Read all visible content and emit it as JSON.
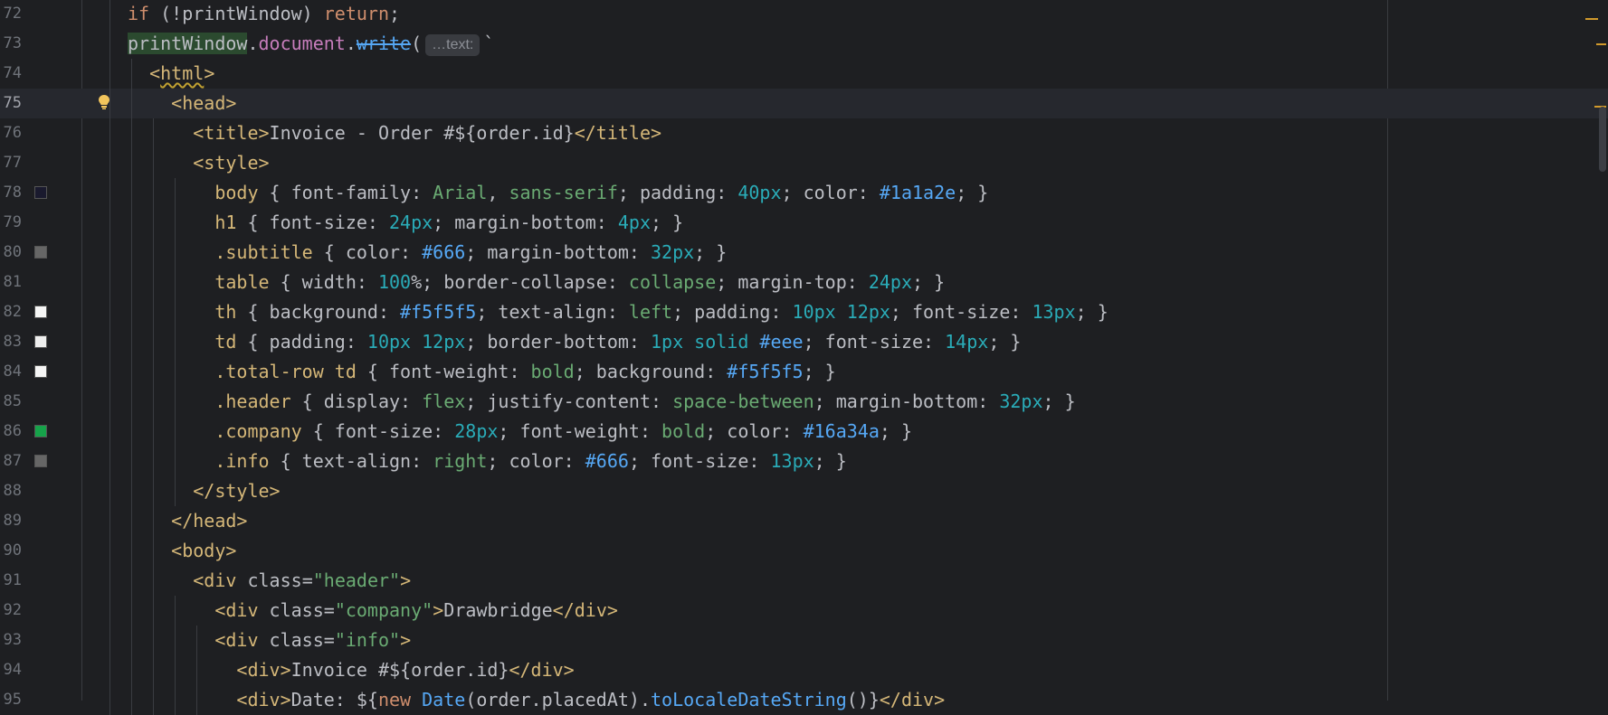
{
  "editor": {
    "lines": [
      {
        "num": "72",
        "swatch": null,
        "indent": "",
        "tokens": [
          {
            "t": "if",
            "c": "t-kw"
          },
          {
            "t": " (!printWindow) ",
            "c": "t-var"
          },
          {
            "t": "return",
            "c": "t-kw"
          },
          {
            "t": ";",
            "c": "t-var"
          }
        ]
      },
      {
        "num": "73",
        "swatch": null,
        "indent": "",
        "tokens": [
          {
            "t": "printWindow",
            "c": "t-var t-hl"
          },
          {
            "t": ".",
            "c": "t-var"
          },
          {
            "t": "document",
            "c": "t-field"
          },
          {
            "t": ".",
            "c": "t-var"
          },
          {
            "t": "write",
            "c": "t-fn"
          },
          {
            "t": "(",
            "c": "t-var"
          },
          {
            "t": "…text:",
            "c": "hint"
          },
          {
            "t": "`",
            "c": "t-var"
          }
        ]
      },
      {
        "num": "74",
        "swatch": null,
        "indent": "  ",
        "tokens": [
          {
            "t": "<",
            "c": "t-tag"
          },
          {
            "t": "html",
            "c": "t-tag t-warn"
          },
          {
            "t": ">",
            "c": "t-tag"
          }
        ]
      },
      {
        "num": "75",
        "swatch": null,
        "indent": "    ",
        "current": true,
        "tokens": [
          {
            "t": "<head>",
            "c": "t-tag"
          }
        ]
      },
      {
        "num": "76",
        "swatch": null,
        "indent": "      ",
        "tokens": [
          {
            "t": "<title>",
            "c": "t-tag"
          },
          {
            "t": "Invoice - Order #${order.id}",
            "c": "t-var"
          },
          {
            "t": "</title>",
            "c": "t-tag"
          }
        ]
      },
      {
        "num": "77",
        "swatch": null,
        "indent": "      ",
        "tokens": [
          {
            "t": "<style>",
            "c": "t-tag"
          }
        ]
      },
      {
        "num": "78",
        "swatch": "#1a1a2e",
        "indent": "        ",
        "tokens": [
          {
            "t": "body",
            "c": "t-sel"
          },
          {
            "t": " { font-family: ",
            "c": "t-prop"
          },
          {
            "t": "Arial",
            "c": "t-val"
          },
          {
            "t": ", ",
            "c": "t-prop"
          },
          {
            "t": "sans-serif",
            "c": "t-val"
          },
          {
            "t": "; padding: ",
            "c": "t-prop"
          },
          {
            "t": "40px",
            "c": "t-num"
          },
          {
            "t": "; color: ",
            "c": "t-prop"
          },
          {
            "t": "#1a1a2e",
            "c": "t-hex"
          },
          {
            "t": "; }",
            "c": "t-prop"
          }
        ]
      },
      {
        "num": "79",
        "swatch": null,
        "indent": "        ",
        "tokens": [
          {
            "t": "h1",
            "c": "t-sel"
          },
          {
            "t": " { font-size: ",
            "c": "t-prop"
          },
          {
            "t": "24px",
            "c": "t-num"
          },
          {
            "t": "; margin-bottom: ",
            "c": "t-prop"
          },
          {
            "t": "4px",
            "c": "t-num"
          },
          {
            "t": "; }",
            "c": "t-prop"
          }
        ]
      },
      {
        "num": "80",
        "swatch": "#666666",
        "indent": "        ",
        "tokens": [
          {
            "t": ".subtitle",
            "c": "t-sel"
          },
          {
            "t": " { color: ",
            "c": "t-prop"
          },
          {
            "t": "#666",
            "c": "t-hex"
          },
          {
            "t": "; margin-bottom: ",
            "c": "t-prop"
          },
          {
            "t": "32px",
            "c": "t-num"
          },
          {
            "t": "; }",
            "c": "t-prop"
          }
        ]
      },
      {
        "num": "81",
        "swatch": null,
        "indent": "        ",
        "tokens": [
          {
            "t": "table",
            "c": "t-sel"
          },
          {
            "t": " { width: ",
            "c": "t-prop"
          },
          {
            "t": "100",
            "c": "t-num"
          },
          {
            "t": "%; border-collapse: ",
            "c": "t-prop"
          },
          {
            "t": "collapse",
            "c": "t-val"
          },
          {
            "t": "; margin-top: ",
            "c": "t-prop"
          },
          {
            "t": "24px",
            "c": "t-num"
          },
          {
            "t": "; }",
            "c": "t-prop"
          }
        ]
      },
      {
        "num": "82",
        "swatch": "#f5f5f5",
        "indent": "        ",
        "tokens": [
          {
            "t": "th",
            "c": "t-sel"
          },
          {
            "t": " { background: ",
            "c": "t-prop"
          },
          {
            "t": "#f5f5f5",
            "c": "t-hex"
          },
          {
            "t": "; text-align: ",
            "c": "t-prop"
          },
          {
            "t": "left",
            "c": "t-val"
          },
          {
            "t": "; padding: ",
            "c": "t-prop"
          },
          {
            "t": "10px 12px",
            "c": "t-num"
          },
          {
            "t": "; font-size: ",
            "c": "t-prop"
          },
          {
            "t": "13px",
            "c": "t-num"
          },
          {
            "t": "; }",
            "c": "t-prop"
          }
        ]
      },
      {
        "num": "83",
        "swatch": "#eeeeee",
        "indent": "        ",
        "tokens": [
          {
            "t": "td",
            "c": "t-sel"
          },
          {
            "t": " { padding: ",
            "c": "t-prop"
          },
          {
            "t": "10px 12px",
            "c": "t-num"
          },
          {
            "t": "; border-bottom: ",
            "c": "t-prop"
          },
          {
            "t": "1px solid",
            "c": "t-num"
          },
          {
            "t": " ",
            "c": "t-prop"
          },
          {
            "t": "#eee",
            "c": "t-hex"
          },
          {
            "t": "; font-size: ",
            "c": "t-prop"
          },
          {
            "t": "14px",
            "c": "t-num"
          },
          {
            "t": "; }",
            "c": "t-prop"
          }
        ]
      },
      {
        "num": "84",
        "swatch": "#f5f5f5",
        "indent": "        ",
        "tokens": [
          {
            "t": ".total-row td",
            "c": "t-sel"
          },
          {
            "t": " { font-weight: ",
            "c": "t-prop"
          },
          {
            "t": "bold",
            "c": "t-val"
          },
          {
            "t": "; background: ",
            "c": "t-prop"
          },
          {
            "t": "#f5f5f5",
            "c": "t-hex"
          },
          {
            "t": "; }",
            "c": "t-prop"
          }
        ]
      },
      {
        "num": "85",
        "swatch": null,
        "indent": "        ",
        "tokens": [
          {
            "t": ".header",
            "c": "t-sel"
          },
          {
            "t": " { display: ",
            "c": "t-prop"
          },
          {
            "t": "flex",
            "c": "t-val"
          },
          {
            "t": "; justify-content: ",
            "c": "t-prop"
          },
          {
            "t": "space-between",
            "c": "t-val"
          },
          {
            "t": "; margin-bottom: ",
            "c": "t-prop"
          },
          {
            "t": "32px",
            "c": "t-num"
          },
          {
            "t": "; }",
            "c": "t-prop"
          }
        ]
      },
      {
        "num": "86",
        "swatch": "#16a34a",
        "indent": "        ",
        "tokens": [
          {
            "t": ".company",
            "c": "t-sel"
          },
          {
            "t": " { font-size: ",
            "c": "t-prop"
          },
          {
            "t": "28px",
            "c": "t-num"
          },
          {
            "t": "; font-weight: ",
            "c": "t-prop"
          },
          {
            "t": "bold",
            "c": "t-val"
          },
          {
            "t": "; color: ",
            "c": "t-prop"
          },
          {
            "t": "#16a34a",
            "c": "t-hex"
          },
          {
            "t": "; }",
            "c": "t-prop"
          }
        ]
      },
      {
        "num": "87",
        "swatch": "#666666",
        "indent": "        ",
        "tokens": [
          {
            "t": ".info",
            "c": "t-sel"
          },
          {
            "t": " { text-align: ",
            "c": "t-prop"
          },
          {
            "t": "right",
            "c": "t-val"
          },
          {
            "t": "; color: ",
            "c": "t-prop"
          },
          {
            "t": "#666",
            "c": "t-hex"
          },
          {
            "t": "; font-size: ",
            "c": "t-prop"
          },
          {
            "t": "13px",
            "c": "t-num"
          },
          {
            "t": "; }",
            "c": "t-prop"
          }
        ]
      },
      {
        "num": "88",
        "swatch": null,
        "indent": "      ",
        "tokens": [
          {
            "t": "</style>",
            "c": "t-tag"
          }
        ]
      },
      {
        "num": "89",
        "swatch": null,
        "indent": "    ",
        "tokens": [
          {
            "t": "</head>",
            "c": "t-tag"
          }
        ]
      },
      {
        "num": "90",
        "swatch": null,
        "indent": "    ",
        "tokens": [
          {
            "t": "<body>",
            "c": "t-tag"
          }
        ]
      },
      {
        "num": "91",
        "swatch": null,
        "indent": "      ",
        "tokens": [
          {
            "t": "<div ",
            "c": "t-tag"
          },
          {
            "t": "class",
            "c": "t-attr"
          },
          {
            "t": "=",
            "c": "t-var"
          },
          {
            "t": "\"header\"",
            "c": "t-str"
          },
          {
            "t": ">",
            "c": "t-tag"
          }
        ]
      },
      {
        "num": "92",
        "swatch": null,
        "indent": "        ",
        "tokens": [
          {
            "t": "<div ",
            "c": "t-tag"
          },
          {
            "t": "class",
            "c": "t-attr"
          },
          {
            "t": "=",
            "c": "t-var"
          },
          {
            "t": "\"company\"",
            "c": "t-str"
          },
          {
            "t": ">",
            "c": "t-tag"
          },
          {
            "t": "Drawbridge",
            "c": "t-var"
          },
          {
            "t": "</div>",
            "c": "t-tag"
          }
        ]
      },
      {
        "num": "93",
        "swatch": null,
        "indent": "        ",
        "tokens": [
          {
            "t": "<div ",
            "c": "t-tag"
          },
          {
            "t": "class",
            "c": "t-attr"
          },
          {
            "t": "=",
            "c": "t-var"
          },
          {
            "t": "\"info\"",
            "c": "t-str"
          },
          {
            "t": ">",
            "c": "t-tag"
          }
        ]
      },
      {
        "num": "94",
        "swatch": null,
        "indent": "          ",
        "tokens": [
          {
            "t": "<div>",
            "c": "t-tag"
          },
          {
            "t": "Invoice #${order.id}",
            "c": "t-var"
          },
          {
            "t": "</div>",
            "c": "t-tag"
          }
        ]
      },
      {
        "num": "95",
        "swatch": null,
        "indent": "          ",
        "tokens": [
          {
            "t": "<div>",
            "c": "t-tag"
          },
          {
            "t": "Date: ${",
            "c": "t-var"
          },
          {
            "t": "new",
            "c": "t-kw"
          },
          {
            "t": " ",
            "c": "t-var"
          },
          {
            "t": "Date",
            "c": "t-method"
          },
          {
            "t": "(order.placedAt).",
            "c": "t-var"
          },
          {
            "t": "toLocaleDateString",
            "c": "t-method"
          },
          {
            "t": "()}",
            "c": "t-var"
          },
          {
            "t": "</div>",
            "c": "t-tag"
          }
        ]
      }
    ]
  }
}
